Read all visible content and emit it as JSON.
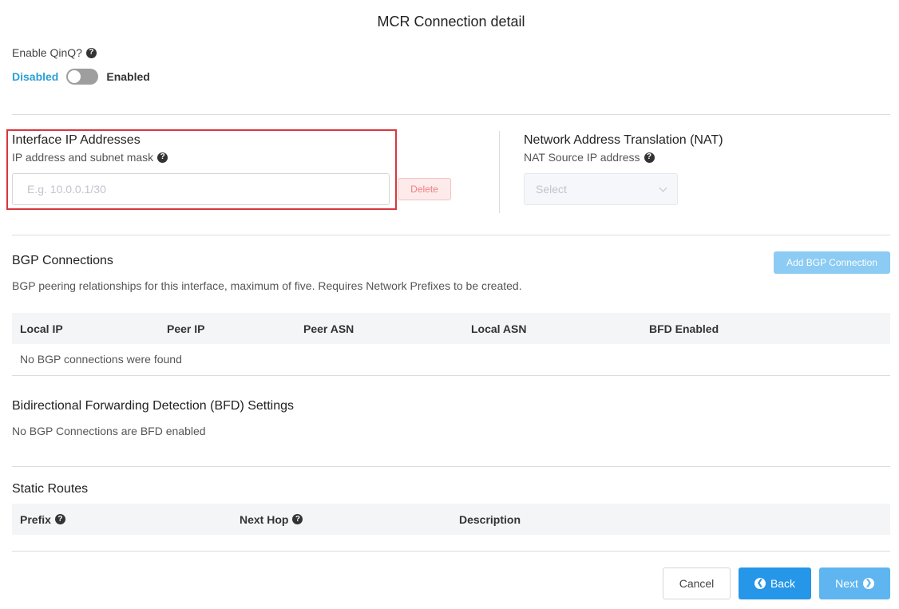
{
  "page_title": "MCR Connection detail",
  "qinq": {
    "label": "Enable QinQ?",
    "off_label": "Disabled",
    "on_label": "Enabled",
    "enabled": false
  },
  "interface": {
    "heading": "Interface IP Addresses",
    "sublabel": "IP address and subnet mask",
    "input_value": "",
    "input_placeholder": "E.g. 10.0.0.1/30",
    "delete_label": "Delete"
  },
  "nat": {
    "heading": "Network Address Translation (NAT)",
    "sublabel": "NAT Source IP address",
    "select_placeholder": "Select"
  },
  "bgp": {
    "heading": "BGP Connections",
    "add_button": "Add BGP Connection",
    "description": "BGP peering relationships for this interface, maximum of five. Requires Network Prefixes to be created.",
    "columns": [
      "Local IP",
      "Peer IP",
      "Peer ASN",
      "Local ASN",
      "BFD Enabled"
    ],
    "empty_text": "No BGP connections were found"
  },
  "bfd": {
    "heading": "Bidirectional Forwarding Detection (BFD) Settings",
    "empty_text": "No BGP Connections are BFD enabled"
  },
  "static_routes": {
    "heading": "Static Routes",
    "columns": [
      "Prefix",
      "Next Hop",
      "Description"
    ]
  },
  "footer": {
    "cancel": "Cancel",
    "back": "Back",
    "next": "Next"
  },
  "colors": {
    "accent": "#2696e8",
    "toggle_off_text": "#2a9fd6",
    "highlight_border": "#d9363e"
  },
  "icons": {
    "help": "question-circle",
    "back": "arrow-circle-left",
    "next": "arrow-circle-right",
    "select": "chevron-down"
  }
}
